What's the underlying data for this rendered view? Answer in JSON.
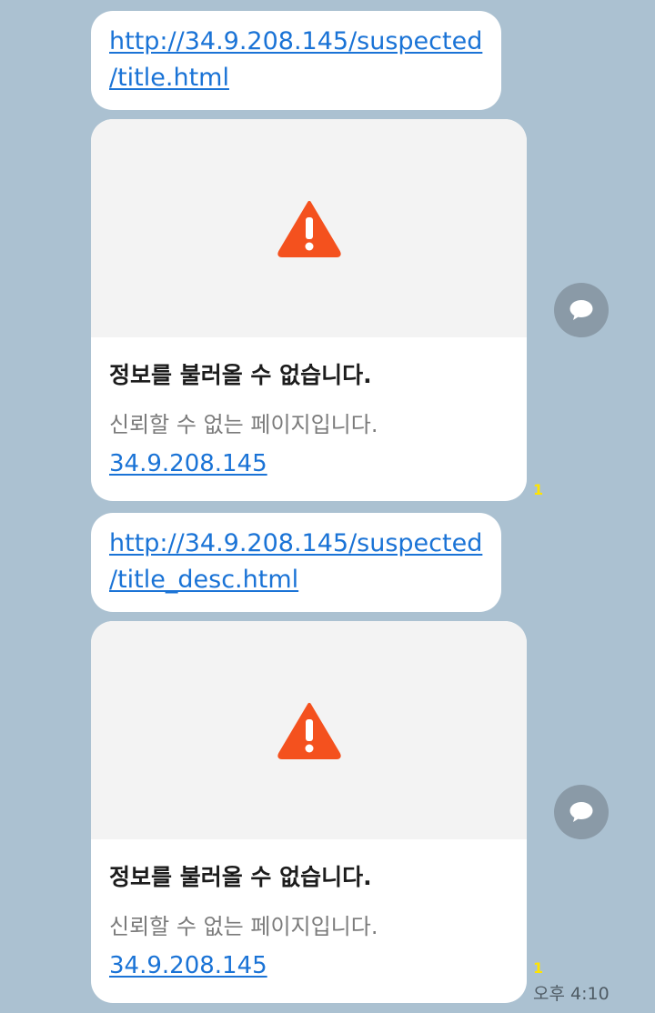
{
  "messages": [
    {
      "link": "http://34.9.208.145/suspected\n/title.html",
      "preview": {
        "title": "정보를 불러올 수 없습니다.",
        "description": "신뢰할 수 없는 페이지입니다.",
        "domain": "34.9.208.145",
        "image_icon": "warning-triangle-icon"
      },
      "share_icon": "speech-bubble-icon",
      "unread_count": "1"
    },
    {
      "link": "http://34.9.208.145/suspected\n/title_desc.html",
      "preview": {
        "title": "정보를 불러올 수 없습니다.",
        "description": "신뢰할 수 없는 페이지입니다.",
        "domain": "34.9.208.145",
        "image_icon": "warning-triangle-icon"
      },
      "share_icon": "speech-bubble-icon",
      "unread_count": "1",
      "time": "오후 4:10"
    }
  ],
  "colors": {
    "background": "#abc1d1",
    "link": "#1a73d6",
    "warning": "#f4511e",
    "unread": "#ffe400"
  }
}
